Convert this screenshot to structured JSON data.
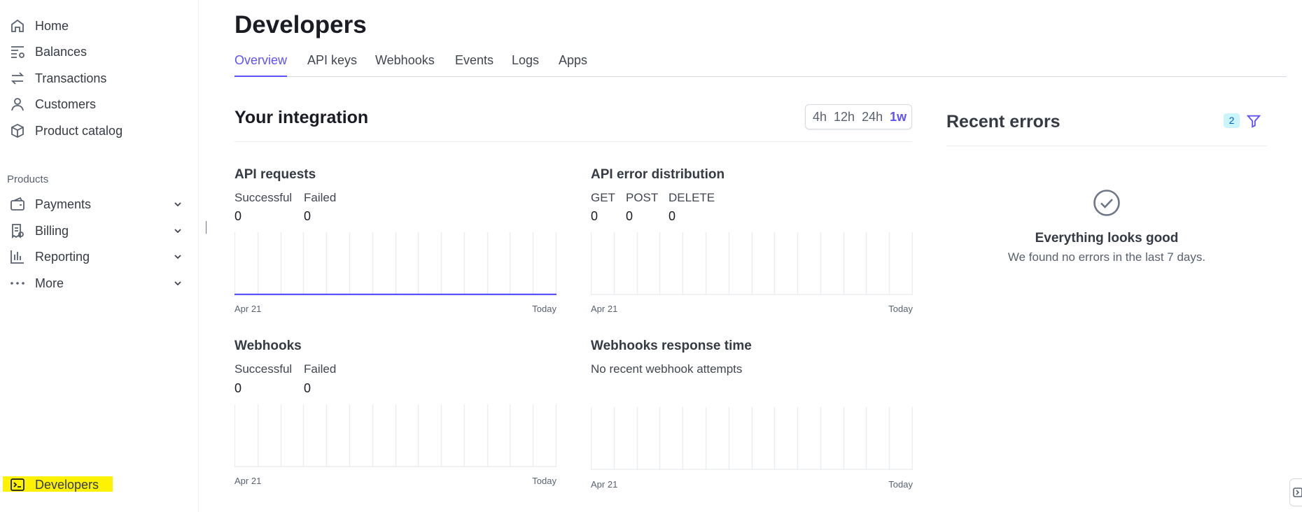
{
  "sidebar": {
    "top_items": [
      {
        "label": "Home",
        "icon": "home-icon"
      },
      {
        "label": "Balances",
        "icon": "balances-icon"
      },
      {
        "label": "Transactions",
        "icon": "transactions-icon"
      },
      {
        "label": "Customers",
        "icon": "customers-icon"
      },
      {
        "label": "Product catalog",
        "icon": "product-catalog-icon"
      }
    ],
    "section_label": "Products",
    "product_items": [
      {
        "label": "Payments",
        "icon": "payments-icon"
      },
      {
        "label": "Billing",
        "icon": "billing-icon"
      },
      {
        "label": "Reporting",
        "icon": "reporting-icon"
      },
      {
        "label": "More",
        "icon": "more-icon"
      }
    ],
    "bottom_item": {
      "label": "Developers",
      "icon": "terminal-icon",
      "highlight_color": "#fff200"
    }
  },
  "header": {
    "title": "Developers",
    "tabs": [
      {
        "label": "Overview",
        "active": true
      },
      {
        "label": "API keys"
      },
      {
        "label": "Webhooks"
      },
      {
        "label": "Events"
      },
      {
        "label": "Logs"
      },
      {
        "label": "Apps"
      }
    ]
  },
  "integration": {
    "title": "Your integration",
    "time_ranges": [
      {
        "label": "4h"
      },
      {
        "label": "12h"
      },
      {
        "label": "24h"
      },
      {
        "label": "1w",
        "active": true
      }
    ],
    "api_requests": {
      "title": "API requests",
      "metrics": [
        {
          "label": "Successful",
          "value": "0"
        },
        {
          "label": "Failed",
          "value": "0"
        }
      ],
      "x_start": "Apr 21",
      "x_end": "Today"
    },
    "api_errors": {
      "title": "API error distribution",
      "metrics": [
        {
          "label": "GET",
          "value": "0"
        },
        {
          "label": "POST",
          "value": "0"
        },
        {
          "label": "DELETE",
          "value": "0"
        }
      ],
      "x_start": "Apr 21",
      "x_end": "Today"
    },
    "webhooks": {
      "title": "Webhooks",
      "metrics": [
        {
          "label": "Successful",
          "value": "0"
        },
        {
          "label": "Failed",
          "value": "0"
        }
      ],
      "x_start": "Apr 21",
      "x_end": "Today"
    },
    "webhooks_response": {
      "title": "Webhooks response time",
      "note": "No recent webhook attempts",
      "x_start": "Apr 21",
      "x_end": "Today"
    }
  },
  "recent_errors": {
    "title": "Recent errors",
    "badge_count": "2",
    "empty_title": "Everything looks good",
    "empty_desc": "We found no errors in the last 7 days."
  },
  "colors": {
    "accent": "#5e52ff",
    "text_primary": "#1a1b25",
    "badge_bg": "#cbf5fd"
  }
}
